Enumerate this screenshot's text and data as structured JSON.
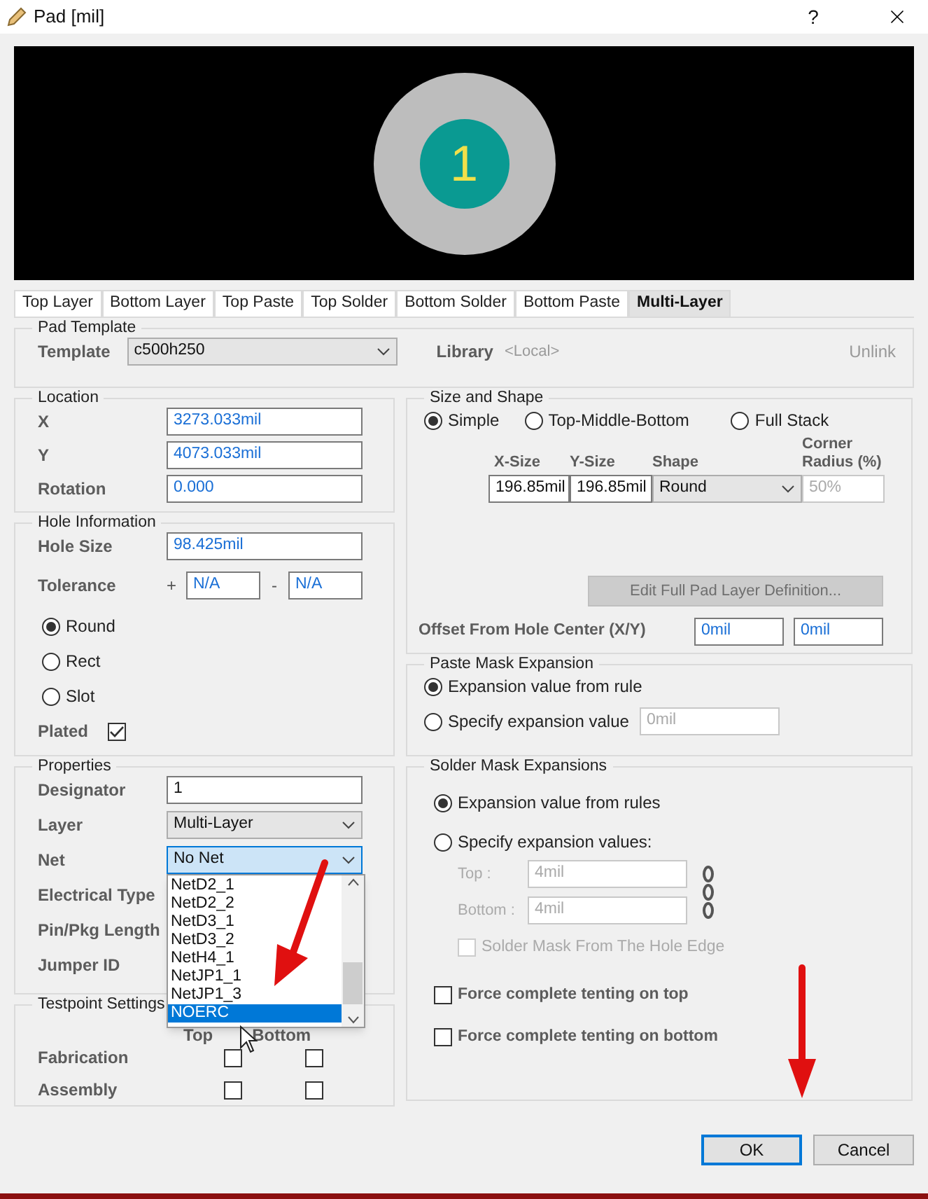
{
  "window": {
    "title": "Pad [mil]",
    "help": "?"
  },
  "preview": {
    "pad_label": "1"
  },
  "tabs": [
    {
      "label": "Top Layer",
      "selected": false
    },
    {
      "label": "Bottom Layer",
      "selected": false
    },
    {
      "label": "Top Paste",
      "selected": false
    },
    {
      "label": "Top Solder",
      "selected": false
    },
    {
      "label": "Bottom Solder",
      "selected": false
    },
    {
      "label": "Bottom Paste",
      "selected": false
    },
    {
      "label": "Multi-Layer",
      "selected": true
    }
  ],
  "pad_template": {
    "title": "Pad Template",
    "template_label": "Template",
    "template_value": "c500h250",
    "library_label": "Library",
    "library_value": "<Local>",
    "unlink": "Unlink"
  },
  "location": {
    "title": "Location",
    "fields": [
      {
        "label": "X",
        "value": "3273.033mil"
      },
      {
        "label": "Y",
        "value": "4073.033mil"
      },
      {
        "label": "Rotation",
        "value": "0.000"
      }
    ]
  },
  "hole_information": {
    "title": "Hole Information",
    "hole_size_label": "Hole Size",
    "hole_size": "98.425mil",
    "tolerance_label": "Tolerance",
    "plus": "+",
    "plus_value": "N/A",
    "minus": "-",
    "minus_value": "N/A",
    "shapes": [
      {
        "label": "Round",
        "selected": true
      },
      {
        "label": "Rect",
        "selected": false
      },
      {
        "label": "Slot",
        "selected": false
      }
    ],
    "plated_label": "Plated",
    "plated": true
  },
  "properties": {
    "title": "Properties",
    "fields": [
      {
        "kind": "input",
        "label": "Designator",
        "value": "1"
      },
      {
        "kind": "select",
        "label": "Layer",
        "value": "Multi-Layer"
      },
      {
        "kind": "net",
        "label": "Net",
        "value": "No Net"
      },
      {
        "kind": "hidden",
        "label": "Electrical Type"
      },
      {
        "kind": "hidden",
        "label": "Pin/Pkg Length"
      },
      {
        "kind": "hidden",
        "label": "Jumper ID"
      }
    ],
    "net_options": [
      {
        "label": "NetD2_1",
        "selected": false
      },
      {
        "label": "NetD2_2",
        "selected": false
      },
      {
        "label": "NetD3_1",
        "selected": false
      },
      {
        "label": "NetD3_2",
        "selected": false
      },
      {
        "label": "NetH4_1",
        "selected": false
      },
      {
        "label": "NetJP1_1",
        "selected": false
      },
      {
        "label": "NetJP1_3",
        "selected": false
      },
      {
        "label": "NOERC",
        "selected": true
      }
    ]
  },
  "testpoint_settings": {
    "title": "Testpoint Settings",
    "columns": [
      "Top",
      "Bottom"
    ],
    "rows": [
      {
        "label": "Fabrication",
        "top": false,
        "bottom": false
      },
      {
        "label": "Assembly",
        "top": false,
        "bottom": false
      }
    ]
  },
  "size_and_shape": {
    "title": "Size and Shape",
    "modes": [
      {
        "label": "Simple",
        "selected": true
      },
      {
        "label": "Top-Middle-Bottom",
        "selected": false
      },
      {
        "label": "Full Stack",
        "selected": false
      }
    ],
    "columns": [
      "X-Size",
      "Y-Size",
      "Shape",
      "Corner Radius (%)"
    ],
    "x_size": "196.85mil",
    "y_size": "196.85mil",
    "shape": "Round",
    "corner_radius": "50%",
    "edit_button": "Edit Full Pad Layer Definition...",
    "offset_label": "Offset From Hole Center (X/Y)",
    "offset_x": "0mil",
    "offset_y": "0mil"
  },
  "paste_mask": {
    "title": "Paste Mask Expansion",
    "options": [
      {
        "label": "Expansion value from rule",
        "selected": true
      },
      {
        "label": "Specify expansion value",
        "selected": false
      }
    ],
    "value": "0mil"
  },
  "solder_mask": {
    "title": "Solder Mask Expansions",
    "options": [
      {
        "label": "Expansion value from rules",
        "selected": true
      },
      {
        "label": "Specify expansion values:",
        "selected": false
      }
    ],
    "top_label": "Top :",
    "top_value": "4mil",
    "bottom_label": "Bottom :",
    "bottom_value": "4mil",
    "hole_edge_label": "Solder Mask From The Hole Edge",
    "hole_edge": false,
    "tenting": [
      {
        "label": "Force complete tenting on top",
        "checked": false
      },
      {
        "label": "Force complete tenting on bottom",
        "checked": false
      }
    ]
  },
  "buttons": [
    {
      "label": "OK",
      "focused": true
    },
    {
      "label": "Cancel",
      "focused": false
    }
  ]
}
